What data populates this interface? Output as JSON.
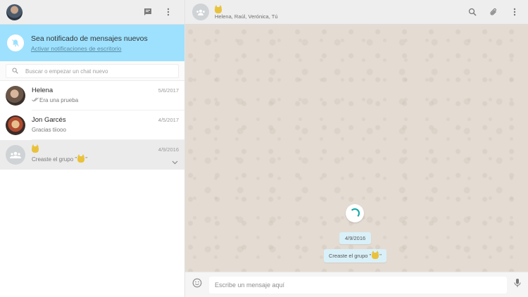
{
  "left_header": {
    "icons": [
      "profile-avatar",
      "new-chat-icon",
      "menu-dots-icon"
    ]
  },
  "notification": {
    "title": "Sea notificado de mensajes nuevos",
    "link": "Activar notificaciones de escritorio",
    "icon": "bell-muted-icon"
  },
  "search": {
    "placeholder": "Buscar o empezar un chat nuevo"
  },
  "chats": [
    {
      "name": "Helena",
      "date": "5/6/2017",
      "preview": "Era una prueba",
      "status_icon": "double-check-icon"
    },
    {
      "name": "Jon Garcés",
      "date": "4/5/2017",
      "preview": "Gracias tiiooo"
    },
    {
      "name": "",
      "date": "4/9/2016",
      "preview_prefix": "Creaste el grupo \"",
      "preview_suffix": "\"",
      "group_emoji": "cat-emoji"
    }
  ],
  "chat_header": {
    "members": "Helena, Raúl, Verónica, Tú",
    "icons": [
      "search-icon",
      "attach-icon",
      "menu-dots-icon"
    ]
  },
  "conversation": {
    "date": "4/9/2016",
    "system_message_prefix": "Creaste el grupo \"",
    "system_message_suffix": "\""
  },
  "composer": {
    "placeholder": "Escribe un mensaje aquí"
  },
  "colors": {
    "notification_bg": "#9de1fe",
    "accent": "#12a5a5",
    "system_pill": "#d9f0f8",
    "wallpaper": "#e4dcd3"
  }
}
